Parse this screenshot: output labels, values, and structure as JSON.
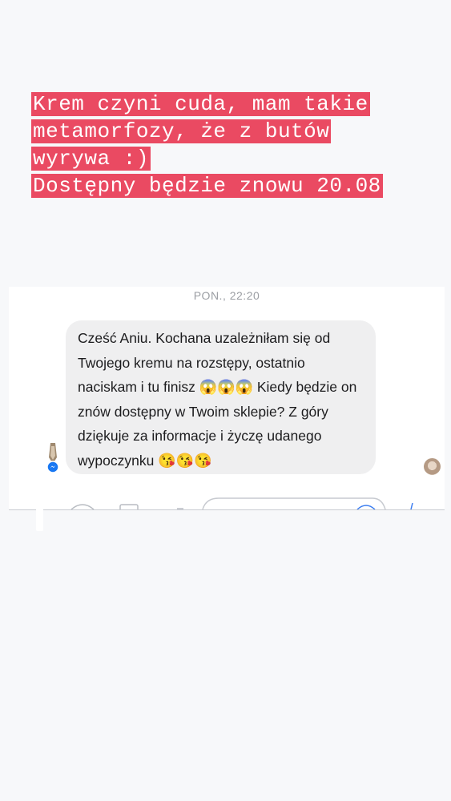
{
  "caption": {
    "lines": [
      "Krem czyni cuda, mam takie",
      "metamorfozy, że z butów",
      "wyrywa :)",
      "Dostępny będzie znowu 20.08"
    ]
  },
  "chat": {
    "timestamp": "PON., 22:20",
    "message": {
      "part1": "Cześć Aniu. Kochana uzależniłam się od Twojego kremu na rozstępy, ostatnio naciskam i tu finisz ",
      "emoji1": "😱😱😱",
      "part2": " Kiedy będzie on znów dostępny w Twoim sklepie? Z góry dziękuje za informacje i życzę udanego wypoczynku ",
      "emoji2": "😘😘😘"
    }
  },
  "colors": {
    "caption_highlight": "#ea4a62",
    "bubble_bg": "#efeff0",
    "messenger_badge": "#1877f2"
  },
  "icons": {
    "sender_avatar": "avatar-icon",
    "messenger_badge": "messenger-icon",
    "read_receipt": "read-receipt-avatar-icon"
  }
}
